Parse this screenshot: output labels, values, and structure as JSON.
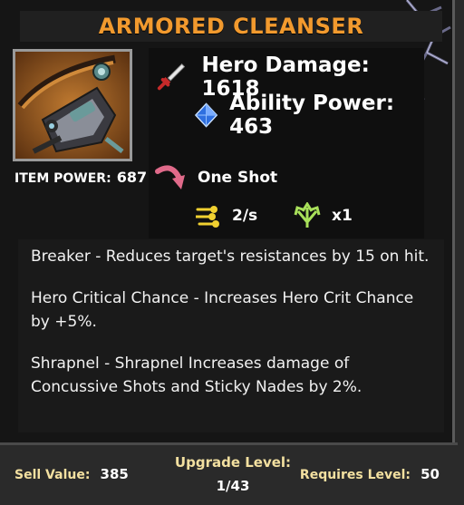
{
  "item": {
    "name": "ARMORED CLEANSER",
    "image_icon": "armored-cleanser-weapon-icon",
    "item_power_label": "ITEM POWER:",
    "item_power_value": "687"
  },
  "stats": {
    "hero_damage": "Hero Damage: 1618",
    "ability_power": "Ability Power: 463",
    "attack_type": "One Shot",
    "attack_rate": "2/s",
    "projectiles": "x1"
  },
  "descriptions": [
    "Breaker - Reduces target's resistances by 15 on hit.",
    "Hero Critical Chance - Increases Hero Crit Chance by +5%.",
    "Shrapnel - Shrapnel  Increases damage of Concussive Shots and Sticky Nades by 2%."
  ],
  "footer": {
    "sell_label": "Sell Value:",
    "sell_value": "385",
    "upgrade_label": "Upgrade Level:",
    "upgrade_value": "1/43",
    "requires_label": "Requires Level:",
    "requires_value": "50"
  },
  "colors": {
    "title": "#f29a2e",
    "footer_label": "#f3e0a0",
    "damage_icon": "#c62a2a",
    "ability_icon": "#2e6fe0",
    "attack_icon": "#e06a8a",
    "rate_icon": "#f0d030",
    "projectile_icon": "#a8e05a"
  }
}
